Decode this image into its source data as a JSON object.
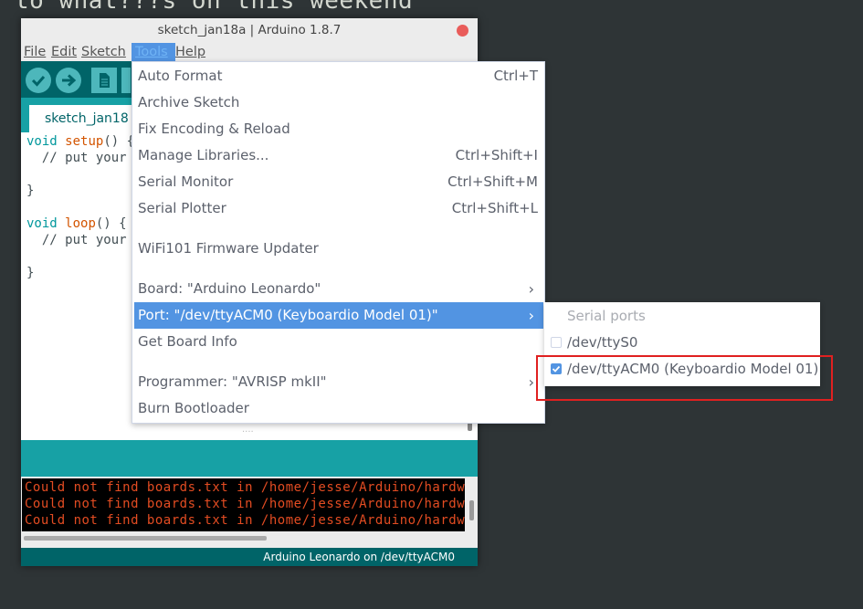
{
  "background": {
    "text": "to what???s on this weekend"
  },
  "window": {
    "title": "sketch_jan18a | Arduino 1.8.7",
    "menus": [
      "File",
      "Edit",
      "Sketch",
      "Tools",
      "Help"
    ],
    "tab": {
      "label": "sketch_jan18"
    },
    "code": {
      "line1_kw": "void",
      "line1_fn": "setup",
      "line1_rest": "() {",
      "line2": "  // put your",
      "line3": "}",
      "line5_kw": "void",
      "line5_fn": "loop",
      "line5_rest": "() {",
      "line6": "  // put your",
      "line7": "}"
    },
    "resize_dots": "....",
    "console_lines": [
      "Could not find boards.txt in /home/jesse/Arduino/hardw",
      "Could not find boards.txt in /home/jesse/Arduino/hardw",
      "Could not find boards.txt in /home/jesse/Arduino/hardw"
    ],
    "status": "Arduino Leonardo on /dev/ttyACM0"
  },
  "tools_menu": {
    "items": [
      {
        "label": "Auto Format",
        "shortcut": "Ctrl+T"
      },
      {
        "label": "Archive Sketch",
        "shortcut": ""
      },
      {
        "label": "Fix Encoding & Reload",
        "shortcut": ""
      },
      {
        "label": "Manage Libraries...",
        "shortcut": "Ctrl+Shift+I"
      },
      {
        "label": "Serial Monitor",
        "shortcut": "Ctrl+Shift+M"
      },
      {
        "label": "Serial Plotter",
        "shortcut": "Ctrl+Shift+L"
      },
      {
        "label": "WiFi101 Firmware Updater",
        "shortcut": ""
      },
      {
        "label": "Board: \"Arduino Leonardo\"",
        "shortcut": ""
      },
      {
        "label": "Port: \"/dev/ttyACM0 (Keyboardio Model 01)\"",
        "shortcut": ""
      },
      {
        "label": "Get Board Info",
        "shortcut": ""
      },
      {
        "label": "Programmer: \"AVRISP mkII\"",
        "shortcut": ""
      },
      {
        "label": "Burn Bootloader",
        "shortcut": ""
      }
    ],
    "submenu_arrow": "›"
  },
  "port_submenu": {
    "header": "Serial ports",
    "items": [
      {
        "label": "/dev/ttyS0",
        "checked": false
      },
      {
        "label": "/dev/ttyACM0 (Keyboardio Model 01)",
        "checked": true
      }
    ]
  },
  "colors": {
    "accent": "#5294e2",
    "arduino_teal_dark": "#006468",
    "arduino_teal": "#17a1a5",
    "error_text": "#e34c22",
    "annotation_red": "#e02020"
  },
  "icons": [
    "verify-icon",
    "upload-icon",
    "new-icon",
    "open-icon",
    "close-icon",
    "chevron-right-icon",
    "checkbox-icon"
  ]
}
